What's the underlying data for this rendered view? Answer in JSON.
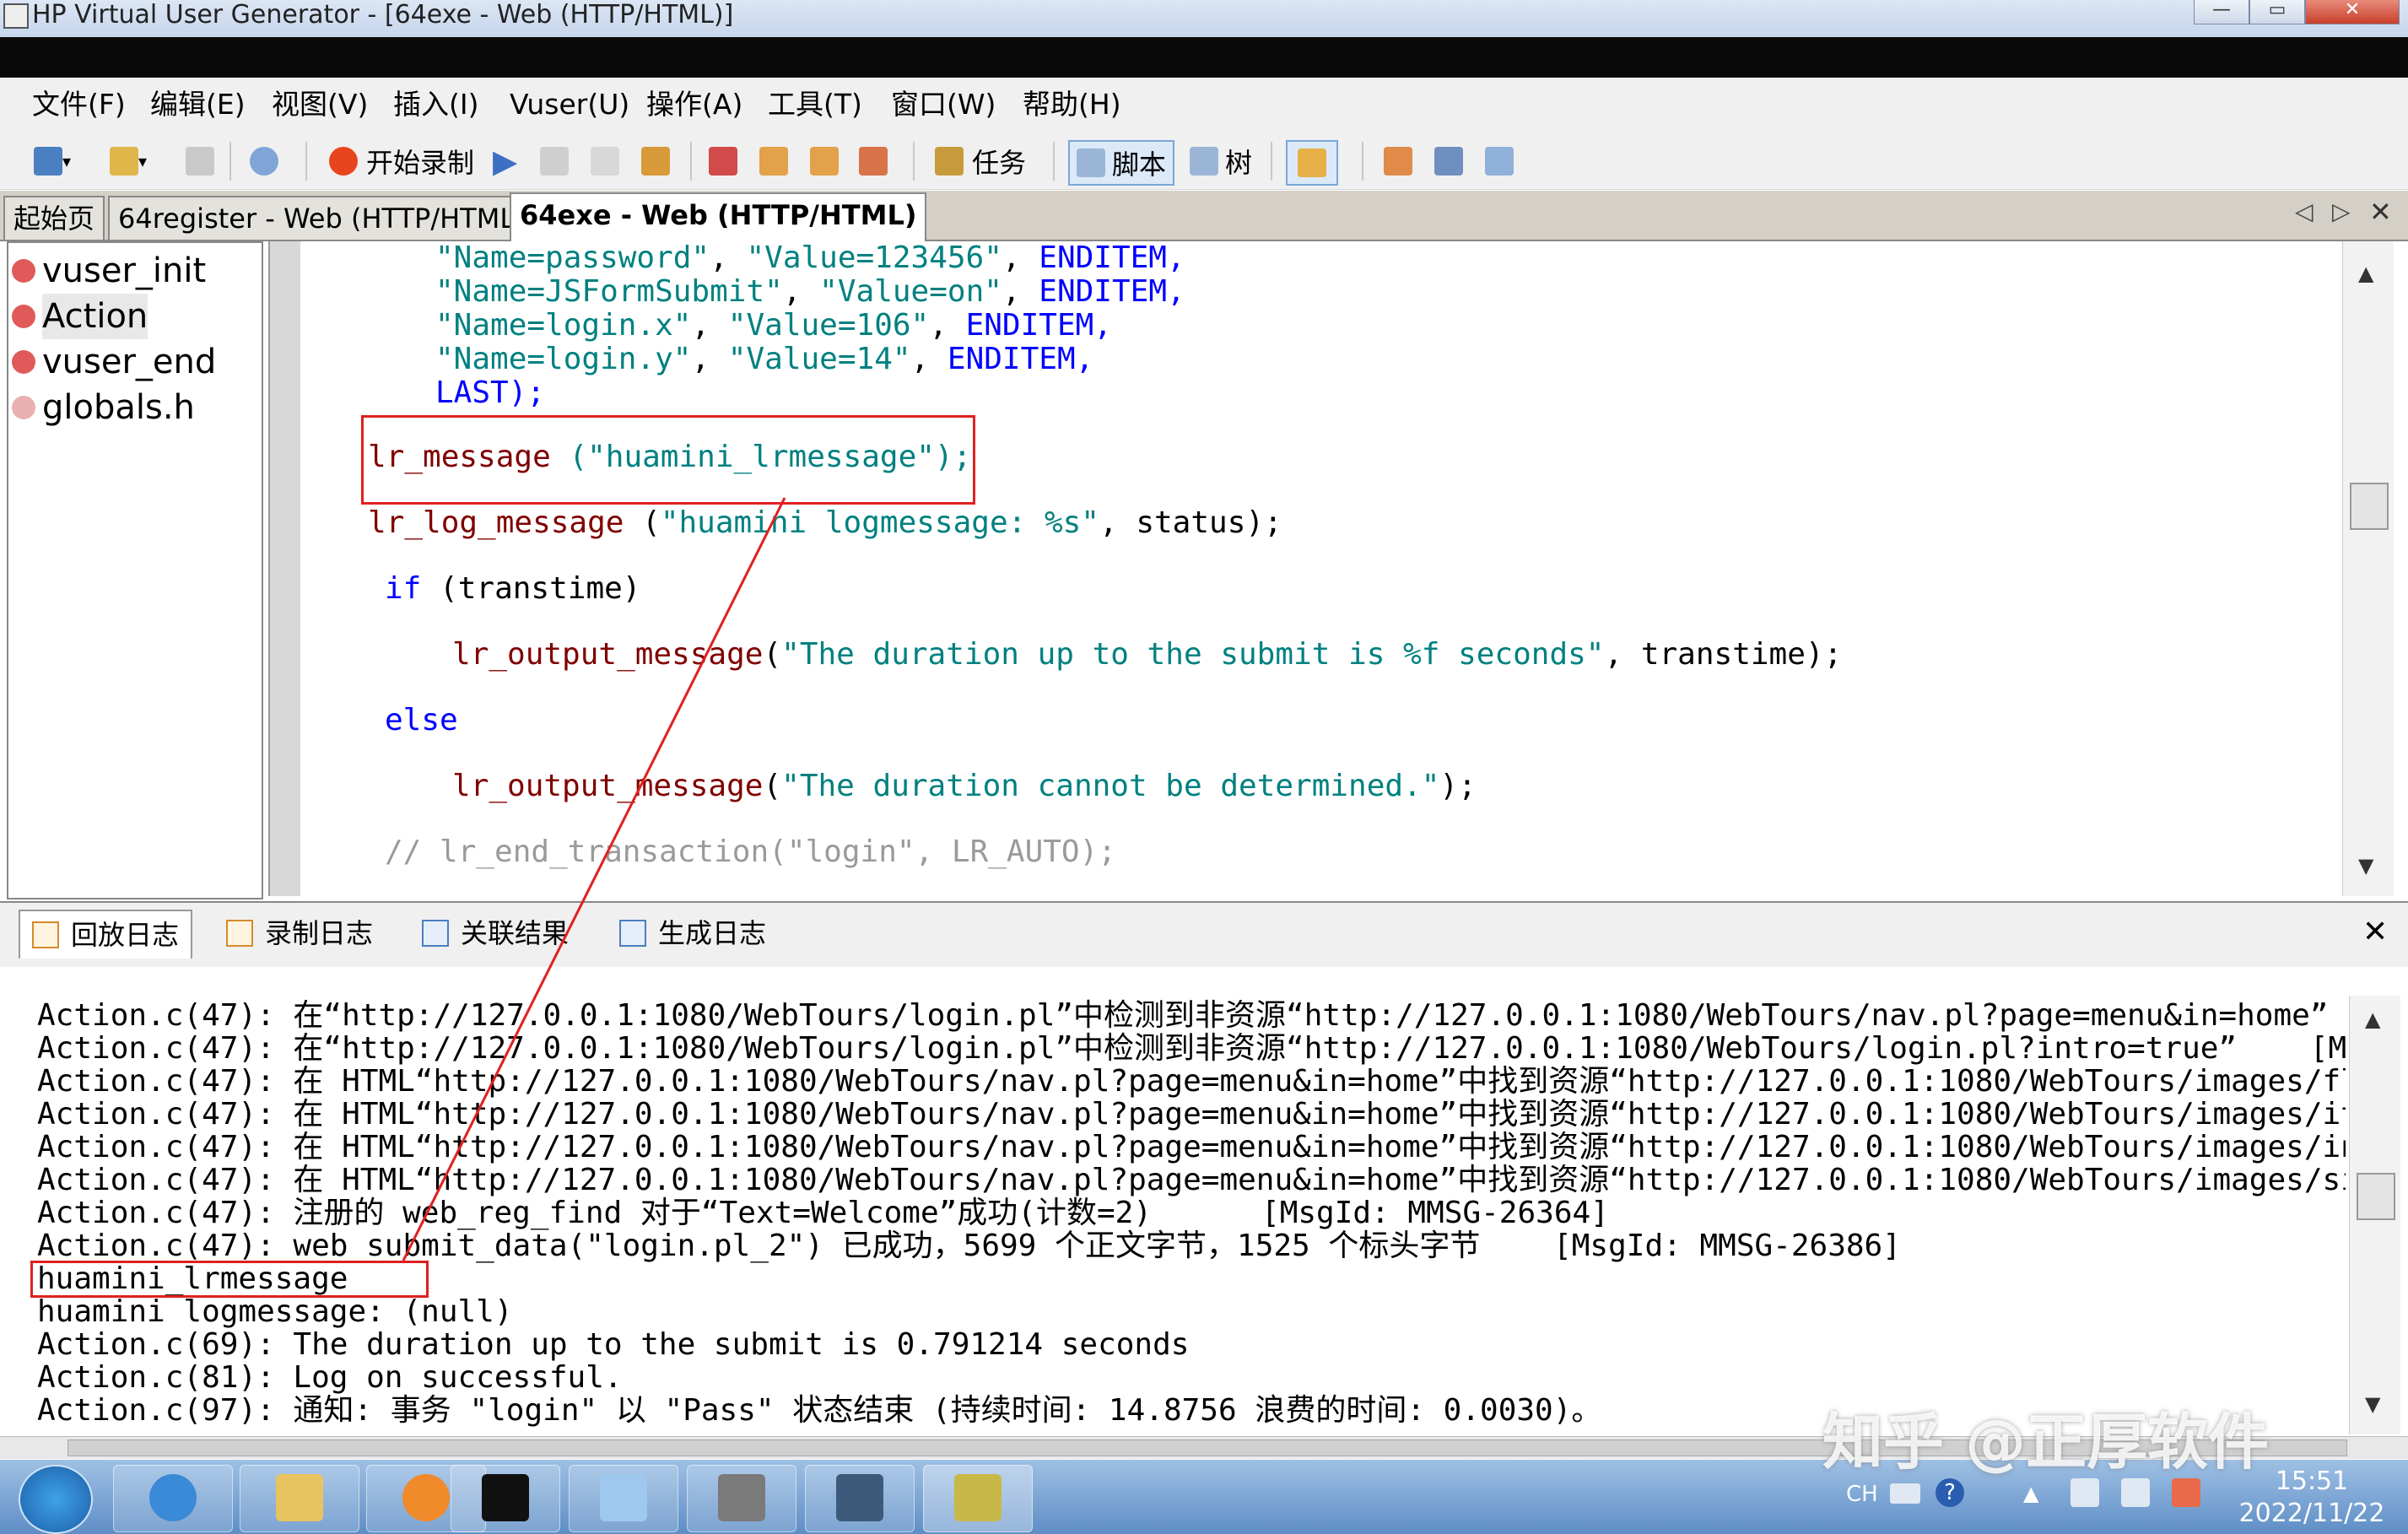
{
  "window": {
    "title": "HP Virtual User Generator - [64exe - Web (HTTP/HTML)]"
  },
  "menu": [
    "文件(F)",
    "编辑(E)",
    "视图(V)",
    "插入(I)",
    "Vuser(U)",
    "操作(A)",
    "工具(T)",
    "窗口(W)",
    "帮助(H)"
  ],
  "toolbar": {
    "record_label": "开始录制",
    "tasks_label": "任务",
    "script_label": "脚本",
    "tree_label": "树"
  },
  "doc_tabs": [
    "起始页",
    "64register - Web (HTTP/HTML)",
    "64exe - Web (HTTP/HTML)"
  ],
  "tree": [
    "vuser_init",
    "Action",
    "vuser_end",
    "globals.h"
  ],
  "code": {
    "l1a": "\"Name=password\"",
    "l1b": "\"Value=123456\"",
    "l1c": "ENDITEM,",
    "l2a": "\"Name=JSFormSubmit\"",
    "l2b": "\"Value=on\"",
    "l2c": "ENDITEM,",
    "l3a": "\"Name=login.x\"",
    "l3b": "\"Value=106\"",
    "l3c": "ENDITEM,",
    "l4a": "\"Name=login.y\"",
    "l4b": "\"Value=14\"",
    "l4c": "ENDITEM,",
    "l5": "LAST);",
    "m1fn": "lr_message",
    "m1arg": "(\"huamini_lrmessage\");",
    "m2fn": "lr_log_message",
    "m2open": "(",
    "m2str": "\"huamini logmessage: %s\"",
    "m2rest": ", status);",
    "if_kw": "if",
    "if_rest": "(transtime)",
    "o1fn": "lr_output_message",
    "o1open": "(",
    "o1str": "\"The duration up to the submit is %f seconds\"",
    "o1rest": ", transtime);",
    "else_kw": "else",
    "o2fn": "lr_output_message",
    "o2open": "(",
    "o2str": "\"The duration cannot be determined.\"",
    "o2rest": ");",
    "comment": "// lr_end_transaction(\"login\", LR_AUTO);"
  },
  "log_tabs": [
    "回放日志",
    "录制日志",
    "关联结果",
    "生成日志"
  ],
  "log": {
    "l1": "Action.c(47): 在“http://127.0.0.1:1080/WebTours/login.pl”中检测到非资源“http://127.0.0.1:1080/WebTours/nav.pl?page=menu&in=home”",
    "l2": "Action.c(47): 在“http://127.0.0.1:1080/WebTours/login.pl”中检测到非资源“http://127.0.0.1:1080/WebTours/login.pl?intro=true”    [Ms",
    "l3": "Action.c(47): 在 HTML“http://127.0.0.1:1080/WebTours/nav.pl?page=menu&in=home”中找到资源“http://127.0.0.1:1080/WebTours/images/fligh",
    "l4": "Action.c(47): 在 HTML“http://127.0.0.1:1080/WebTours/nav.pl?page=menu&in=home”中找到资源“http://127.0.0.1:1080/WebTours/images/itine",
    "l5": "Action.c(47): 在 HTML“http://127.0.0.1:1080/WebTours/nav.pl?page=menu&in=home”中找到资源“http://127.0.0.1:1080/WebTours/images/in_ho",
    "l6": "Action.c(47): 在 HTML“http://127.0.0.1:1080/WebTours/nav.pl?page=menu&in=home”中找到资源“http://127.0.0.1:1080/WebTours/images/signo",
    "l7": "Action.c(47): 注册的 web_reg_find 对于“Text=Welcome”成功(计数=2)      [MsgId: MMSG-26364]",
    "l8": "Action.c(47): web_submit_data(\"login.pl_2\") 已成功，5699 个正文字节，1525 个标头字节    [MsgId: MMSG-26386]",
    "l9": "huamini_lrmessage",
    "l10": "huamini logmessage: (null)",
    "l11": "Action.c(69): The duration up to the submit is 0.791214 seconds",
    "l12": "Action.c(81): Log on successful.",
    "l13": "Action.c(97): 通知: 事务 \"login\" 以 \"Pass\" 状态结束 (持续时间: 14.8756 浪费的时间: 0.0030)。"
  },
  "taskbar": {
    "ime": "CH",
    "time": "15:51",
    "date": "2022/11/22"
  },
  "watermark": "知乎 @正厚软件",
  "colors": {
    "keyword": "#0000ff",
    "string": "#008080",
    "annotation": "#e02020"
  }
}
